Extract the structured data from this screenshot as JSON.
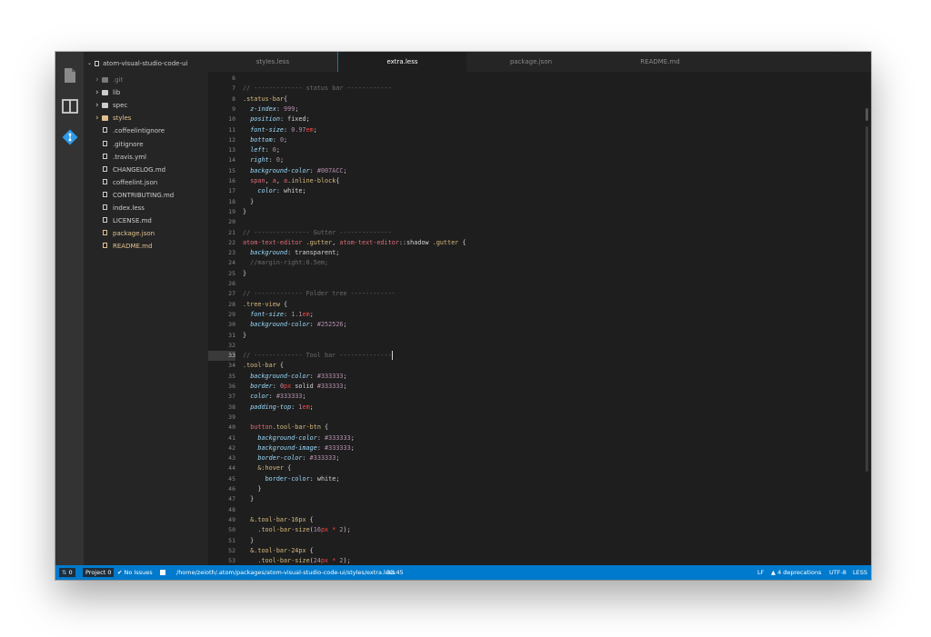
{
  "sidebar": {
    "root_label": "atom-visual-studio-code-ui",
    "items": [
      {
        "label": ".git",
        "type": "folder",
        "color": "#7b7b7b"
      },
      {
        "label": "lib",
        "type": "folder",
        "color": "#cccccc"
      },
      {
        "label": "spec",
        "type": "folder",
        "color": "#cccccc"
      },
      {
        "label": "styles",
        "type": "folder-open",
        "color": "#e2c08d"
      },
      {
        "label": ".coffeelintignore",
        "type": "file",
        "color": "#cccccc"
      },
      {
        "label": ".gitignore",
        "type": "file",
        "color": "#cccccc"
      },
      {
        "label": ".travis.yml",
        "type": "file",
        "color": "#cccccc"
      },
      {
        "label": "CHANGELOG.md",
        "type": "file",
        "color": "#cccccc"
      },
      {
        "label": "coffeelint.json",
        "type": "file",
        "color": "#cccccc"
      },
      {
        "label": "CONTRIBUTING.md",
        "type": "file",
        "color": "#cccccc"
      },
      {
        "label": "index.less",
        "type": "file",
        "color": "#cccccc"
      },
      {
        "label": "LICENSE.md",
        "type": "file",
        "color": "#cccccc"
      },
      {
        "label": "package.json",
        "type": "file",
        "color": "#e2c08d"
      },
      {
        "label": "README.md",
        "type": "book",
        "color": "#e2c08d"
      }
    ]
  },
  "tabs": [
    {
      "label": "styles.less",
      "active": false
    },
    {
      "label": "extra.less",
      "active": true
    },
    {
      "label": "package.json",
      "active": false
    },
    {
      "label": "README.md",
      "active": false
    }
  ],
  "editor": {
    "cursor_line": "33",
    "lines": [
      {
        "n": "6",
        "t": []
      },
      {
        "n": "7",
        "t": [
          {
            "s": "// ------------- status bar ------------",
            "c": "#6a6a6a"
          }
        ]
      },
      {
        "n": "8",
        "t": [
          {
            "s": ".status-bar",
            "c": "#d7ba7d"
          },
          {
            "s": "{",
            "c": "#d4d4d4"
          }
        ]
      },
      {
        "n": "9",
        "t": [
          {
            "s": "  ",
            "c": "#d4d4d4"
          },
          {
            "s": "z-index",
            "c": "#9cdcfe",
            "i": true
          },
          {
            "s": ": ",
            "c": "#d4d4d4"
          },
          {
            "s": "999",
            "c": "#b48ead"
          },
          {
            "s": ";",
            "c": "#d4d4d4"
          }
        ]
      },
      {
        "n": "10",
        "t": [
          {
            "s": "  ",
            "c": "#d4d4d4"
          },
          {
            "s": "position",
            "c": "#9cdcfe",
            "i": true
          },
          {
            "s": ": fixed;",
            "c": "#d4d4d4"
          }
        ]
      },
      {
        "n": "11",
        "t": [
          {
            "s": "  ",
            "c": "#d4d4d4"
          },
          {
            "s": "font-size",
            "c": "#9cdcfe",
            "i": true
          },
          {
            "s": ": ",
            "c": "#d4d4d4"
          },
          {
            "s": "0.97",
            "c": "#b48ead"
          },
          {
            "s": "em",
            "c": "#f44747"
          },
          {
            "s": ";",
            "c": "#d4d4d4"
          }
        ]
      },
      {
        "n": "12",
        "t": [
          {
            "s": "  ",
            "c": "#d4d4d4"
          },
          {
            "s": "bottom",
            "c": "#9cdcfe",
            "i": true
          },
          {
            "s": ": ",
            "c": "#d4d4d4"
          },
          {
            "s": "0",
            "c": "#b48ead"
          },
          {
            "s": ";",
            "c": "#d4d4d4"
          }
        ]
      },
      {
        "n": "13",
        "t": [
          {
            "s": "  ",
            "c": "#d4d4d4"
          },
          {
            "s": "left",
            "c": "#9cdcfe",
            "i": true
          },
          {
            "s": ": ",
            "c": "#d4d4d4"
          },
          {
            "s": "0",
            "c": "#b48ead"
          },
          {
            "s": ";",
            "c": "#d4d4d4"
          }
        ]
      },
      {
        "n": "14",
        "t": [
          {
            "s": "  ",
            "c": "#d4d4d4"
          },
          {
            "s": "right",
            "c": "#9cdcfe",
            "i": true
          },
          {
            "s": ": ",
            "c": "#d4d4d4"
          },
          {
            "s": "0",
            "c": "#b48ead"
          },
          {
            "s": ";",
            "c": "#d4d4d4"
          }
        ]
      },
      {
        "n": "15",
        "t": [
          {
            "s": "  ",
            "c": "#d4d4d4"
          },
          {
            "s": "background-color",
            "c": "#9cdcfe",
            "i": true
          },
          {
            "s": ": ",
            "c": "#d4d4d4"
          },
          {
            "s": "#007ACC",
            "c": "#b48ead"
          },
          {
            "s": ";",
            "c": "#d4d4d4"
          }
        ]
      },
      {
        "n": "16",
        "t": [
          {
            "s": "  ",
            "c": "#d4d4d4"
          },
          {
            "s": "span",
            "c": "#e06c75"
          },
          {
            "s": ", ",
            "c": "#d4d4d4"
          },
          {
            "s": "a",
            "c": "#e06c75"
          },
          {
            "s": ", ",
            "c": "#d4d4d4"
          },
          {
            "s": "a",
            "c": "#e06c75"
          },
          {
            "s": ".inline-block",
            "c": "#d7ba7d"
          },
          {
            "s": "{",
            "c": "#d4d4d4"
          }
        ]
      },
      {
        "n": "17",
        "t": [
          {
            "s": "    ",
            "c": "#d4d4d4"
          },
          {
            "s": "color",
            "c": "#9cdcfe",
            "i": true
          },
          {
            "s": ": white;",
            "c": "#d4d4d4"
          }
        ]
      },
      {
        "n": "18",
        "t": [
          {
            "s": "  }",
            "c": "#d4d4d4"
          }
        ]
      },
      {
        "n": "19",
        "t": [
          {
            "s": "}",
            "c": "#d4d4d4"
          }
        ]
      },
      {
        "n": "20",
        "t": []
      },
      {
        "n": "21",
        "t": [
          {
            "s": "// --------------- Gutter --------------",
            "c": "#6a6a6a"
          }
        ]
      },
      {
        "n": "22",
        "t": [
          {
            "s": "atom-text-editor",
            "c": "#e06c75"
          },
          {
            "s": " ",
            "c": "#d4d4d4"
          },
          {
            "s": ".gutter",
            "c": "#d7ba7d"
          },
          {
            "s": ", ",
            "c": "#d4d4d4"
          },
          {
            "s": "atom-text-editor",
            "c": "#e06c75"
          },
          {
            "s": "::shadow",
            "c": "#d4d4d4"
          },
          {
            "s": " .gutter",
            "c": "#d7ba7d"
          },
          {
            "s": " {",
            "c": "#d4d4d4"
          }
        ]
      },
      {
        "n": "23",
        "t": [
          {
            "s": "  ",
            "c": "#d4d4d4"
          },
          {
            "s": "background",
            "c": "#9cdcfe",
            "i": true
          },
          {
            "s": ": transparent;",
            "c": "#d4d4d4"
          }
        ]
      },
      {
        "n": "24",
        "t": [
          {
            "s": "  //margin-right:0.5em;",
            "c": "#6a6a6a"
          }
        ]
      },
      {
        "n": "25",
        "t": [
          {
            "s": "}",
            "c": "#d4d4d4"
          }
        ]
      },
      {
        "n": "26",
        "t": []
      },
      {
        "n": "27",
        "t": [
          {
            "s": "// ------------- Folder tree ------------",
            "c": "#6a6a6a"
          }
        ]
      },
      {
        "n": "28",
        "t": [
          {
            "s": ".tree-view",
            "c": "#d7ba7d"
          },
          {
            "s": " {",
            "c": "#d4d4d4"
          }
        ]
      },
      {
        "n": "29",
        "t": [
          {
            "s": "  ",
            "c": "#d4d4d4"
          },
          {
            "s": "font-size",
            "c": "#9cdcfe",
            "i": true
          },
          {
            "s": ": ",
            "c": "#d4d4d4"
          },
          {
            "s": "1.1",
            "c": "#b48ead"
          },
          {
            "s": "em",
            "c": "#f44747"
          },
          {
            "s": ";",
            "c": "#d4d4d4"
          }
        ]
      },
      {
        "n": "30",
        "t": [
          {
            "s": "  ",
            "c": "#d4d4d4"
          },
          {
            "s": "background-color",
            "c": "#9cdcfe",
            "i": true
          },
          {
            "s": ": ",
            "c": "#d4d4d4"
          },
          {
            "s": "#252526",
            "c": "#b48ead"
          },
          {
            "s": ";",
            "c": "#d4d4d4"
          }
        ]
      },
      {
        "n": "31",
        "t": [
          {
            "s": "}",
            "c": "#d4d4d4"
          }
        ]
      },
      {
        "n": "32",
        "t": []
      },
      {
        "n": "33",
        "t": [
          {
            "s": "// ------------- Tool bar --------------",
            "c": "#6a6a6a"
          }
        ],
        "cursor": true
      },
      {
        "n": "34",
        "t": [
          {
            "s": ".tool-bar",
            "c": "#d7ba7d"
          },
          {
            "s": " {",
            "c": "#d4d4d4"
          }
        ]
      },
      {
        "n": "35",
        "t": [
          {
            "s": "  ",
            "c": "#d4d4d4"
          },
          {
            "s": "background-color",
            "c": "#9cdcfe",
            "i": true
          },
          {
            "s": ": ",
            "c": "#d4d4d4"
          },
          {
            "s": "#333333",
            "c": "#b48ead"
          },
          {
            "s": ";",
            "c": "#d4d4d4"
          }
        ]
      },
      {
        "n": "36",
        "t": [
          {
            "s": "  ",
            "c": "#d4d4d4"
          },
          {
            "s": "border",
            "c": "#9cdcfe",
            "i": true
          },
          {
            "s": ": ",
            "c": "#d4d4d4"
          },
          {
            "s": "0",
            "c": "#b48ead"
          },
          {
            "s": "px",
            "c": "#f44747"
          },
          {
            "s": " solid ",
            "c": "#d4d4d4"
          },
          {
            "s": "#333333",
            "c": "#b48ead"
          },
          {
            "s": ";",
            "c": "#d4d4d4"
          }
        ]
      },
      {
        "n": "37",
        "t": [
          {
            "s": "  ",
            "c": "#d4d4d4"
          },
          {
            "s": "color",
            "c": "#9cdcfe",
            "i": true
          },
          {
            "s": ": ",
            "c": "#d4d4d4"
          },
          {
            "s": "#333333",
            "c": "#b48ead"
          },
          {
            "s": ";",
            "c": "#d4d4d4"
          }
        ]
      },
      {
        "n": "38",
        "t": [
          {
            "s": "  ",
            "c": "#d4d4d4"
          },
          {
            "s": "padding-top",
            "c": "#9cdcfe",
            "i": true
          },
          {
            "s": ": ",
            "c": "#d4d4d4"
          },
          {
            "s": "1",
            "c": "#b48ead"
          },
          {
            "s": "em",
            "c": "#f44747"
          },
          {
            "s": ";",
            "c": "#d4d4d4"
          }
        ]
      },
      {
        "n": "39",
        "t": []
      },
      {
        "n": "40",
        "t": [
          {
            "s": "  ",
            "c": "#d4d4d4"
          },
          {
            "s": "button",
            "c": "#e06c75"
          },
          {
            "s": ".tool-bar-btn",
            "c": "#d7ba7d"
          },
          {
            "s": " {",
            "c": "#d4d4d4"
          }
        ]
      },
      {
        "n": "41",
        "t": [
          {
            "s": "    ",
            "c": "#d4d4d4"
          },
          {
            "s": "background-color",
            "c": "#9cdcfe",
            "i": true
          },
          {
            "s": ": ",
            "c": "#d4d4d4"
          },
          {
            "s": "#333333",
            "c": "#b48ead"
          },
          {
            "s": ";",
            "c": "#d4d4d4"
          }
        ]
      },
      {
        "n": "42",
        "t": [
          {
            "s": "    ",
            "c": "#d4d4d4"
          },
          {
            "s": "background-image",
            "c": "#9cdcfe",
            "i": true
          },
          {
            "s": ": ",
            "c": "#d4d4d4"
          },
          {
            "s": "#333333",
            "c": "#b48ead"
          },
          {
            "s": ";",
            "c": "#d4d4d4"
          }
        ]
      },
      {
        "n": "43",
        "t": [
          {
            "s": "    ",
            "c": "#d4d4d4"
          },
          {
            "s": "border-color",
            "c": "#9cdcfe",
            "i": true
          },
          {
            "s": ": ",
            "c": "#d4d4d4"
          },
          {
            "s": "#333333",
            "c": "#b48ead"
          },
          {
            "s": ";",
            "c": "#d4d4d4"
          }
        ]
      },
      {
        "n": "44",
        "t": [
          {
            "s": "    ",
            "c": "#d4d4d4"
          },
          {
            "s": "&:hover",
            "c": "#d7ba7d"
          },
          {
            "s": " {",
            "c": "#d4d4d4"
          }
        ]
      },
      {
        "n": "45",
        "t": [
          {
            "s": "      ",
            "c": "#d4d4d4"
          },
          {
            "s": "border-color",
            "c": "#9cdcfe"
          },
          {
            "s": ": white;",
            "c": "#d4d4d4"
          }
        ]
      },
      {
        "n": "46",
        "t": [
          {
            "s": "    }",
            "c": "#d4d4d4"
          }
        ]
      },
      {
        "n": "47",
        "t": [
          {
            "s": "  }",
            "c": "#d4d4d4"
          }
        ]
      },
      {
        "n": "48",
        "t": []
      },
      {
        "n": "49",
        "t": [
          {
            "s": "  ",
            "c": "#d4d4d4"
          },
          {
            "s": "&.tool-bar-16px",
            "c": "#d7ba7d"
          },
          {
            "s": " {",
            "c": "#d4d4d4"
          }
        ]
      },
      {
        "n": "50",
        "t": [
          {
            "s": "    ",
            "c": "#d4d4d4"
          },
          {
            "s": ".tool-bar-size",
            "c": "#d7ba7d"
          },
          {
            "s": "(",
            "c": "#d4d4d4"
          },
          {
            "s": "16",
            "c": "#b48ead"
          },
          {
            "s": "px",
            "c": "#f44747"
          },
          {
            "s": " * ",
            "c": "#f44747"
          },
          {
            "s": "2",
            "c": "#b48ead"
          },
          {
            "s": ");",
            "c": "#d4d4d4"
          }
        ]
      },
      {
        "n": "51",
        "t": [
          {
            "s": "  }",
            "c": "#d4d4d4"
          }
        ]
      },
      {
        "n": "52",
        "t": [
          {
            "s": "  ",
            "c": "#d4d4d4"
          },
          {
            "s": "&.tool-bar-24px",
            "c": "#d7ba7d"
          },
          {
            "s": " {",
            "c": "#d4d4d4"
          }
        ]
      },
      {
        "n": "53",
        "t": [
          {
            "s": "    ",
            "c": "#d4d4d4"
          },
          {
            "s": ".tool-bar-size",
            "c": "#d7ba7d"
          },
          {
            "s": "(",
            "c": "#d4d4d4"
          },
          {
            "s": "24",
            "c": "#b48ead"
          },
          {
            "s": "px",
            "c": "#f44747"
          },
          {
            "s": " * ",
            "c": "#f44747"
          },
          {
            "s": "2",
            "c": "#b48ead"
          },
          {
            "s": ");",
            "c": "#d4d4d4"
          }
        ]
      }
    ]
  },
  "statusbar": {
    "git_count": "0",
    "project_label": "Project",
    "project_count": "0",
    "issues": "No Issues",
    "file_path": "/home/zeioth/.atom/packages/atom-visual-studio-code-ui/styles/extra.less",
    "cursor_pos": "33:45",
    "line_ending": "LF",
    "deprecations": "4 deprecations",
    "encoding": "UTF-8",
    "grammar": "LESS"
  },
  "colors": {
    "accent": "#007acc",
    "editor_bg": "#1e1e1e",
    "sidebar_bg": "#252526",
    "activity_bg": "#333333",
    "git_icon": "#2f9be8"
  },
  "icons": {
    "files": "files-icon",
    "split": "split-editor-icon",
    "git": "git-icon"
  }
}
